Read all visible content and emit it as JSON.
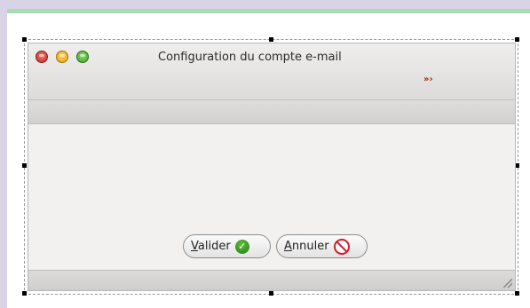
{
  "window": {
    "title": "Configuration du compte e-mail",
    "title_glyph": "»›"
  },
  "buttons": {
    "ok_label": "Valider",
    "cancel_label": "Annuler"
  },
  "icons": {
    "close": "close-icon",
    "minimize": "minimize-icon",
    "maximize": "maximize-icon",
    "ok": "checkmark-icon",
    "cancel": "cancel-icon",
    "resize": "resize-grip-icon"
  },
  "colors": {
    "close": "#e0463a",
    "minimize": "#f5b72a",
    "maximize": "#5bbf3c",
    "ok_icon": "#2e8b1a",
    "cancel_icon": "#d01a2e",
    "canvas_top_border": "#a8dcb4",
    "outer_background": "#d9d3e8"
  }
}
